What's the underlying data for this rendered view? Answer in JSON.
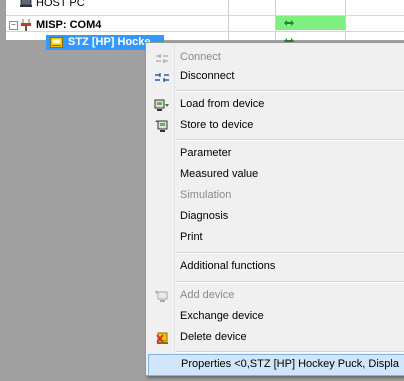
{
  "tree": {
    "host_label": "HOST PC",
    "misp_label": "MISP: COM4",
    "stz_label": "STZ [HP] Hocke",
    "misp_expander": "−"
  },
  "menu": {
    "items": [
      {
        "label": "Connect",
        "icon": "connect-icon",
        "enabled": false
      },
      {
        "label": "Disconnect",
        "icon": "disconnect-icon",
        "enabled": true
      },
      {
        "label": "Load from device",
        "icon": "load-from-device-icon",
        "enabled": true
      },
      {
        "label": "Store to device",
        "icon": "store-to-device-icon",
        "enabled": true
      },
      {
        "label": "Parameter",
        "icon": "",
        "enabled": true
      },
      {
        "label": "Measured value",
        "icon": "",
        "enabled": true
      },
      {
        "label": "Simulation",
        "icon": "",
        "enabled": false
      },
      {
        "label": "Diagnosis",
        "icon": "",
        "enabled": true
      },
      {
        "label": "Print",
        "icon": "",
        "enabled": true
      },
      {
        "label": "Additional functions",
        "icon": "",
        "enabled": true
      },
      {
        "label": "Add device",
        "icon": "add-device-icon",
        "enabled": false
      },
      {
        "label": "Exchange device",
        "icon": "",
        "enabled": true
      },
      {
        "label": "Delete device",
        "icon": "delete-device-icon",
        "enabled": true
      },
      {
        "label": "Properties <0,STZ [HP] Hockey Puck, Displa",
        "icon": "",
        "enabled": true,
        "highlighted": true
      }
    ]
  },
  "colors": {
    "selection": "#3399ff",
    "status_green": "#7ef07e",
    "menu_highlight": "#d1e6fa"
  }
}
